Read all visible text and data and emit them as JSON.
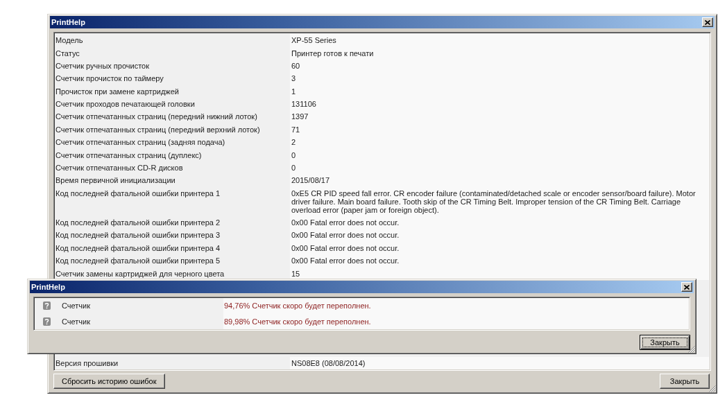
{
  "window": {
    "title": "PrintHelp"
  },
  "properties": {
    "rows": [
      {
        "label": "Модель",
        "value": "XP-55 Series"
      },
      {
        "label": "Статус",
        "value": "Принтер готов к печати"
      },
      {
        "label": "Счетчик ручных прочисток",
        "value": "60"
      },
      {
        "label": "Счетчик прочисток по таймеру",
        "value": "3"
      },
      {
        "label": "Прочисток при замене картриджей",
        "value": "1"
      },
      {
        "label": "Счетчик проходов печатающей головки",
        "value": "131106"
      },
      {
        "label": "Счетчик отпечатанных страниц (передний нижний лоток)",
        "value": "1397"
      },
      {
        "label": "Счетчик отпечатанных страниц (передний верхний лоток)",
        "value": "71"
      },
      {
        "label": "Счетчик отпечатанных страниц (задняя подача)",
        "value": "2"
      },
      {
        "label": "Счетчик отпечатанных страниц (дуплекс)",
        "value": "0"
      },
      {
        "label": "Счетчик отпечатанных CD-R дисков",
        "value": "0"
      },
      {
        "label": "Время первичной инициализации",
        "value": "2015/08/17"
      },
      {
        "label": "Код последней фатальной ошибки принтера 1",
        "value": "0xE5 CR PID speed fall error. CR encoder failure (contaminated/detached scale or encoder sensor/board failure). Motor driver failure. Main board failure. Tooth skip of the CR Timing Belt. Improper tension of the CR Timing Belt. Carriage overload error (paper jam or foreign object)."
      },
      {
        "label": "Код последней фатальной ошибки принтера 2",
        "value": "0x00 Fatal error does not occur."
      },
      {
        "label": "Код последней фатальной ошибки принтера 3",
        "value": "0x00 Fatal error does not occur."
      },
      {
        "label": "Код последней фатальной ошибки принтера 4",
        "value": "0x00 Fatal error does not occur."
      },
      {
        "label": "Код последней фатальной ошибки принтера 5",
        "value": "0x00 Fatal error does not occur."
      },
      {
        "label": "Счетчик замены картриджей для черного цвета",
        "value": "15"
      }
    ],
    "rows_below_dialog": [
      {
        "label": "Версия прошивки",
        "value": "NS08E8 (08/08/2014)"
      }
    ]
  },
  "buttons": [
    {
      "label": "Сбросить историю ошибок",
      "focused": false
    },
    {
      "label": "Закрыть",
      "focused": false
    }
  ],
  "dialog": {
    "title": "PrintHelp",
    "rows": [
      {
        "label": "Счетчик",
        "message": "94,76% Счетчик скоро будет переполнен."
      },
      {
        "label": "Счетчик",
        "message": "89,98% Счетчик скоро будет переполнен."
      }
    ],
    "buttons": [
      {
        "label": "Закрыть",
        "focused": true
      }
    ]
  }
}
